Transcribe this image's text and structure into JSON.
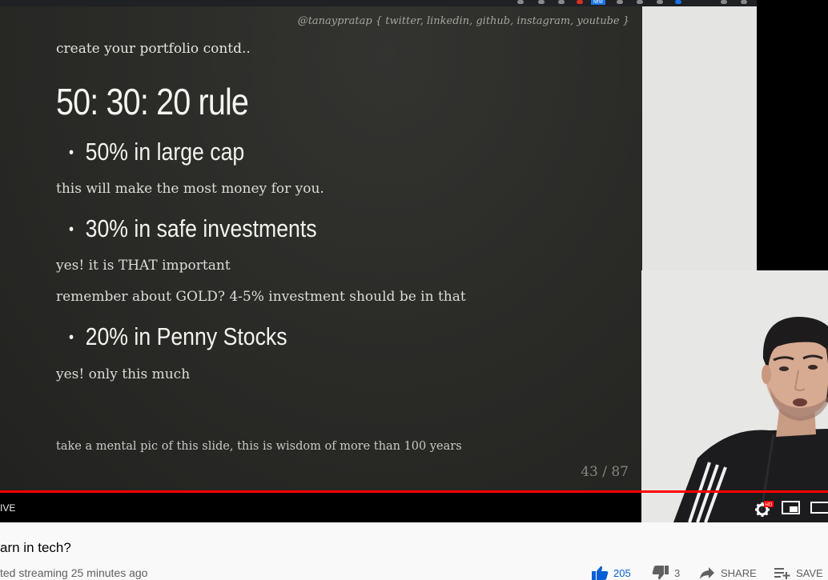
{
  "slide": {
    "handle": "@tanaypratap { twitter, linkedin, github, instagram, youtube }",
    "subtitle": "create your portfolio contd..",
    "heading": "50: 30: 20 rule",
    "bullets": [
      {
        "label": "50% in large cap",
        "notes": [
          "this will make the most money for you."
        ]
      },
      {
        "label": "30% in safe investments",
        "notes": [
          "yes! it is THAT important",
          "remember about GOLD? 4-5% investment should be in that"
        ]
      },
      {
        "label": "20% in Penny Stocks",
        "notes": [
          "yes! only this much"
        ]
      }
    ],
    "footer_note": "take a mental pic of this slide, this is wisdom of more than 100 years",
    "page_counter": "43 / 87"
  },
  "browser": {
    "badge_new": "NEW"
  },
  "player": {
    "live_label": "IVE",
    "progress_fraction": 1.0,
    "settings_badge": "HD",
    "icons": {
      "settings": "gear-icon",
      "miniplayer": "miniplayer-icon",
      "theater": "theater-mode-icon"
    }
  },
  "video": {
    "title": "arn in tech?",
    "meta": "ted streaming 25 minutes ago",
    "likes": "205",
    "dislikes": "3",
    "share_label": "SHARE",
    "save_label": "SAVE"
  },
  "colors": {
    "progress": "#ff0000",
    "like_accent": "#065fd4"
  }
}
